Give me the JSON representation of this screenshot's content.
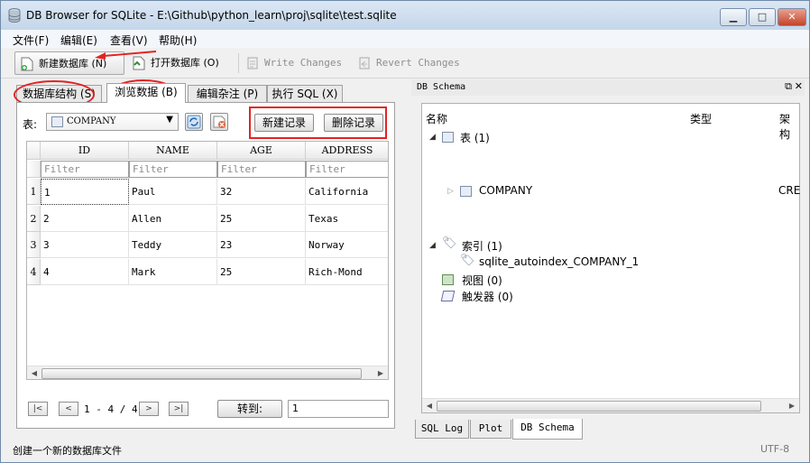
{
  "window": {
    "title": "DB Browser for SQLite - E:\\Github\\python_learn\\proj\\sqlite\\test.sqlite",
    "minimize": "▁",
    "maximize": "□",
    "close": "✕"
  },
  "menu": [
    "文件(F)",
    "编辑(E)",
    "查看(V)",
    "帮助(H)"
  ],
  "toolbar": {
    "new_db": "新建数据库 (N)",
    "open_db": "打开数据库 (O)",
    "write_changes": "Write Changes",
    "revert_changes": "Revert Changes"
  },
  "tabs": [
    "数据库结构 (S)",
    "浏览数据 (B)",
    "编辑杂注 (P)",
    "执行 SQL (X)"
  ],
  "browse": {
    "table_label": "表:",
    "table_value": "COMPANY",
    "new_record": "新建记录",
    "delete_record": "删除记录",
    "columns": [
      "ID",
      "NAME",
      "AGE",
      "ADDRESS"
    ],
    "filter_placeholder": "Filter",
    "rows": [
      {
        "no": "1",
        "cells": [
          "1",
          "Paul",
          "32",
          "California"
        ]
      },
      {
        "no": "2",
        "cells": [
          "2",
          "Allen",
          "25",
          "Texas"
        ]
      },
      {
        "no": "3",
        "cells": [
          "3",
          "Teddy",
          "23",
          "Norway"
        ]
      },
      {
        "no": "4",
        "cells": [
          "4",
          "Mark",
          "25",
          "Rich-Mond"
        ]
      }
    ],
    "nav": {
      "first": "|<",
      "prev": "<",
      "range": "1 - 4 / 4",
      "next": ">",
      "last": ">|",
      "goto": "转到:",
      "goto_value": "1"
    }
  },
  "schema": {
    "dock_title": "DB Schema",
    "columns": [
      "名称",
      "类型",
      "架构"
    ],
    "tables_node": "表 (1)",
    "company": "COMPANY",
    "company_schema": "CRE",
    "index_node": "索引 (1)",
    "index_item": "sqlite_autoindex_COMPANY_1",
    "views_node": "视图 (0)",
    "triggers_node": "触发器 (0)"
  },
  "bottom_tabs": [
    "SQL Log",
    "Plot",
    "DB Schema"
  ],
  "status": {
    "text": "创建一个新的数据库文件",
    "encoding": "UTF-8"
  }
}
